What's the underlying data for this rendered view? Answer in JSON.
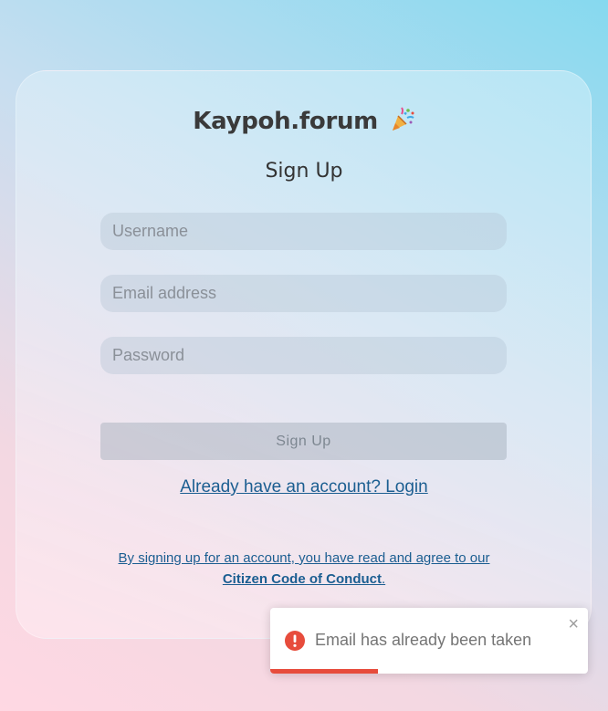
{
  "brand": {
    "name": "Kaypoh.forum",
    "emoji_icon": "party-popper-icon"
  },
  "form": {
    "title": "Sign Up",
    "username_placeholder": "Username",
    "email_placeholder": "Email address",
    "password_placeholder": "Password",
    "submit_label": "Sign Up"
  },
  "links": {
    "login": "Already have an account? Login"
  },
  "terms": {
    "text": "By signing up for an account, you have read and agree to our",
    "code_link": "Citizen Code of Conduct",
    "period": "."
  },
  "toast": {
    "message": "Email has already been taken",
    "icon": "error-icon",
    "close_label": "×",
    "progress": 0.34,
    "color": "#e74c3c"
  },
  "colors": {
    "link": "#1b5e91",
    "error": "#e74c3c"
  }
}
